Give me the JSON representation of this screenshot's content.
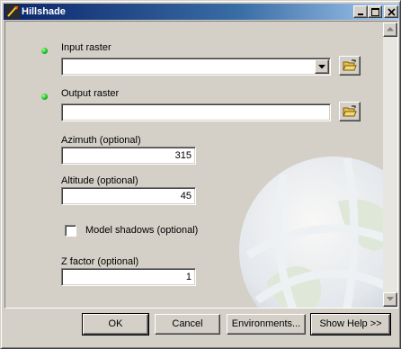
{
  "window": {
    "title": "Hillshade"
  },
  "form": {
    "input_raster": {
      "label": "Input raster",
      "value": ""
    },
    "output_raster": {
      "label": "Output raster",
      "value": ""
    },
    "azimuth": {
      "label": "Azimuth (optional)",
      "value": "315"
    },
    "altitude": {
      "label": "Altitude (optional)",
      "value": "45"
    },
    "model_shadows": {
      "label": "Model shadows (optional)",
      "checked": false
    },
    "z_factor": {
      "label": "Z factor (optional)",
      "value": "1"
    }
  },
  "buttons": {
    "ok": "OK",
    "cancel": "Cancel",
    "environments": "Environments...",
    "show_help": "Show Help >>"
  },
  "icons": {
    "title": "hillshade-tool-icon",
    "required": "required-dot-icon",
    "browse": "open-folder-icon",
    "dropdown": "chevron-down-icon"
  },
  "colors": {
    "titlebar_start": "#0a246a",
    "titlebar_end": "#a6caf0",
    "required_dot": "#11b81f",
    "face": "#d4d0c8"
  }
}
